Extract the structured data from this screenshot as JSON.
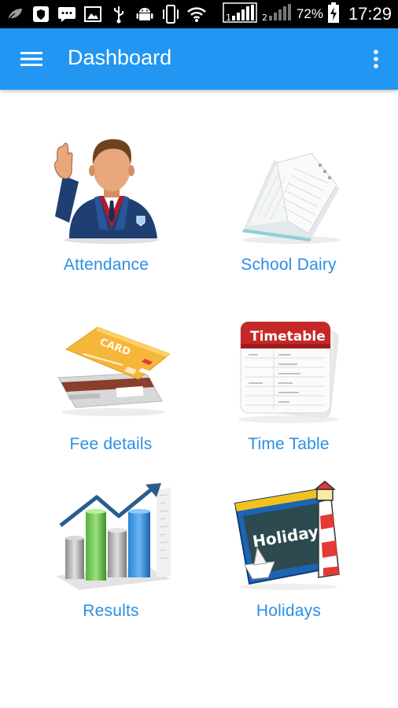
{
  "status_bar": {
    "battery_percent": "72%",
    "time": "17:29",
    "icons": [
      "leaf-icon",
      "shield-icon",
      "message-icon",
      "image-icon",
      "usb-icon",
      "android-icon",
      "vibrate-icon",
      "wifi-icon",
      "signal-1-icon",
      "signal-2-icon",
      "battery-charging-icon"
    ]
  },
  "app_bar": {
    "title": "Dashboard",
    "menu_icon": "hamburger-menu-icon",
    "overflow_icon": "more-vert-icon",
    "color": "#2196f3"
  },
  "tiles": [
    {
      "label": "Attendance",
      "icon": "student-raising-hand-icon"
    },
    {
      "label": "School Dairy",
      "icon": "diary-notebook-icon"
    },
    {
      "label": "Fee details",
      "icon": "credit-card-icon"
    },
    {
      "label": "Time Table",
      "icon": "timetable-icon",
      "icon_text": "Timetable"
    },
    {
      "label": "Results",
      "icon": "bar-chart-growth-icon"
    },
    {
      "label": "Holidays",
      "icon": "holiday-board-icon",
      "icon_text": "Holiday"
    }
  ],
  "label_color": "#2a8fe4"
}
